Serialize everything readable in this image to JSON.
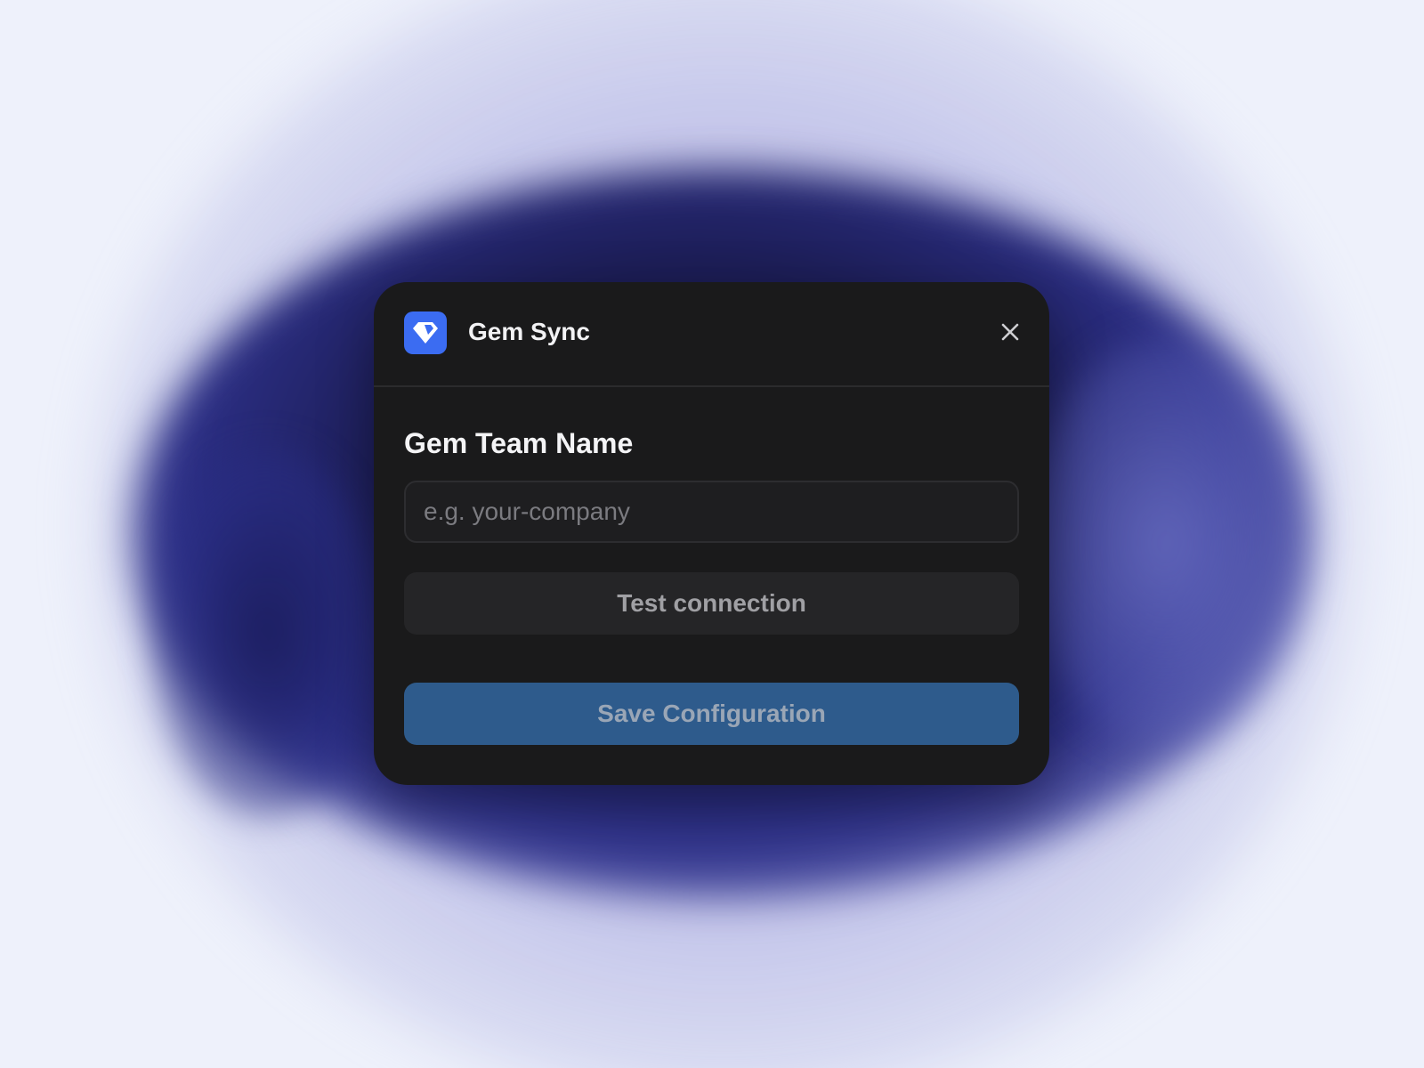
{
  "dialog": {
    "app_icon": "gem-icon",
    "title": "Gem Sync",
    "close_icon": "close-icon"
  },
  "form": {
    "team_name_label": "Gem Team Name",
    "team_name_placeholder": "e.g. your-company",
    "team_name_value": "",
    "test_connection_label": "Test connection",
    "save_label": "Save Configuration"
  },
  "colors": {
    "icon_accent": "#3b6cf2",
    "dialog_bg": "#1a1a1b",
    "primary_button": "#2e5b8c",
    "secondary_button": "#252527"
  }
}
